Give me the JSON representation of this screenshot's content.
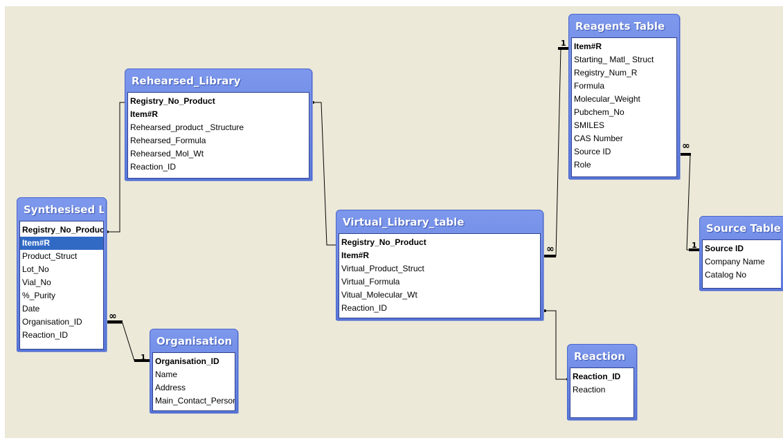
{
  "tables": {
    "rehearsed": {
      "title": "Rehearsed_Library",
      "fields": [
        "Registry_No_Product",
        "Item#R",
        "Rehearsed_product _Structure",
        "Rehearsed_Formula",
        "Rehearsed_Mol_Wt",
        "Reaction_ID"
      ]
    },
    "synthesised": {
      "title": "Synthesised Li…",
      "fields": [
        "Registry_No_Product",
        "Item#R",
        "Product_Struct",
        "Lot_No",
        "Vial_No",
        "%_Purity",
        "Date",
        "Organisation_ID",
        "Reaction_ID"
      ]
    },
    "organisation": {
      "title": "Organisation T…",
      "fields": [
        "Organisation_ID",
        "Name",
        "Address",
        "Main_Contact_Person"
      ]
    },
    "virtual": {
      "title": "Virtual_Library_table",
      "fields": [
        "Registry_No_Product",
        "Item#R",
        "Virtual_Product_Struct",
        "Virtual_Formula",
        "Vitual_Molecular_Wt",
        "Reaction_ID"
      ]
    },
    "reagents": {
      "title": "Reagents Table",
      "fields": [
        "Item#R",
        "Starting_ Matl_ Struct",
        "Registry_Num_R",
        "Formula",
        "Molecular_Weight",
        "Pubchem_No",
        "SMILES",
        "CAS Number",
        "Source ID",
        "Role"
      ]
    },
    "source": {
      "title": "Source Table",
      "fields": [
        "Source ID",
        "Company Name",
        "Catalog No"
      ]
    },
    "reaction": {
      "title": "Reaction",
      "fields": [
        "Reaction_ID",
        "Reaction"
      ]
    }
  },
  "cardinality": {
    "one": "1",
    "many": "∞"
  }
}
